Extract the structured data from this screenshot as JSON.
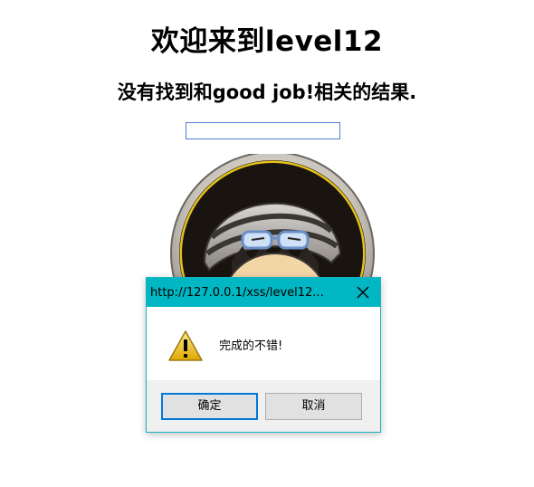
{
  "page": {
    "title": "欢迎来到level12",
    "result_text": "没有找到和good job!相关的结果."
  },
  "search": {
    "value": ""
  },
  "dialog": {
    "title": "http://127.0.0.1/xss/level12...",
    "message": "完成的不错!",
    "ok_label": "确定",
    "cancel_label": "取消",
    "icon": "warning-icon",
    "titlebar_color": "#00b7c3"
  },
  "avatar": {
    "icon": "cartoon-avatar-image"
  }
}
